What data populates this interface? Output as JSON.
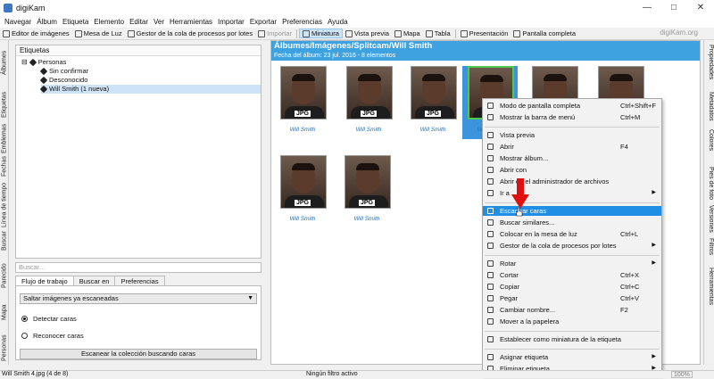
{
  "window": {
    "title": "digiKam"
  },
  "menubar": [
    "Navegar",
    "Álbum",
    "Etiqueta",
    "Elemento",
    "Editar",
    "Ver",
    "Herramientas",
    "Importar",
    "Exportar",
    "Preferencias",
    "Ayuda"
  ],
  "toolbar": {
    "items": [
      {
        "label": "Editor de imágenes",
        "state": "normal"
      },
      {
        "label": "Mesa de Luz",
        "state": "normal"
      },
      {
        "label": "Gestor de la cola de procesos por lotes",
        "state": "normal"
      },
      {
        "label": "Importar",
        "state": "disabled"
      },
      {
        "label": "Miniatura",
        "state": "active"
      },
      {
        "label": "Vista previa",
        "state": "normal"
      },
      {
        "label": "Mapa",
        "state": "normal"
      },
      {
        "label": "Tabla",
        "state": "normal"
      },
      {
        "label": "Presentación",
        "state": "normal"
      },
      {
        "label": "Pantalla completa",
        "state": "normal"
      }
    ],
    "brand": "digiKam.org"
  },
  "left_tabs": [
    "Álbumes",
    "Etiquetas",
    "Emblemas",
    "Fechas",
    "Línea de tiempo",
    "Buscar",
    "Parecido",
    "Mapa",
    "Personas"
  ],
  "right_tabs": [
    "Propiedades",
    "Metadatos",
    "Colores",
    "Pies de foto",
    "Versiones",
    "Filtros",
    "Herramientas"
  ],
  "tag_panel": {
    "header": "Etiquetas",
    "nodes": [
      {
        "label": "Personas",
        "level": 0,
        "selected": false
      },
      {
        "label": "Sin confirmar",
        "level": 1,
        "selected": false
      },
      {
        "label": "Desconocido",
        "level": 1,
        "selected": false
      },
      {
        "label": "Will Smith (1 nueva)",
        "level": 1,
        "selected": true
      }
    ]
  },
  "search": {
    "placeholder": "Buscar..."
  },
  "workflow_tabs": [
    {
      "label": "Flujo de trabajo",
      "active": true
    },
    {
      "label": "Buscar en",
      "active": false
    },
    {
      "label": "Preferencias",
      "active": false
    }
  ],
  "workflow": {
    "combo_value": "Saltar imágenes ya escaneadas",
    "radio_detect": "Detectar caras",
    "radio_recognize": "Reconocer caras",
    "scan_button": "Escanear la colección buscando caras"
  },
  "album": {
    "path": "Álbumes/Imágenes/Splitcam/Will Smith",
    "subtitle": "Fecha del álbum: 23 jul. 2016 - 8 elementos",
    "thumbs": [
      {
        "badge": "JPG",
        "caption": "Will Smith",
        "selected": false
      },
      {
        "badge": "JPG",
        "caption": "Will Smith",
        "selected": false
      },
      {
        "badge": "JPG",
        "caption": "Will Smith",
        "selected": false
      },
      {
        "badge": "JPG",
        "caption": "Will Smith",
        "selected": true
      },
      {
        "badge": "JPG",
        "caption": "Will Smith",
        "selected": false
      },
      {
        "badge": "JPG",
        "caption": "Will Smith",
        "selected": false
      },
      {
        "badge": "JPG",
        "caption": "Will Smith",
        "selected": false
      },
      {
        "badge": "JPG",
        "caption": "Will Smith",
        "selected": false
      }
    ]
  },
  "context_menu": {
    "items": [
      {
        "label": "Modo de pantalla completa",
        "shortcut": "Ctrl+Shift+F",
        "submenu": false,
        "highlighted": false,
        "sep_before": false
      },
      {
        "label": "Mostrar la barra de menú",
        "shortcut": "Ctrl+M",
        "submenu": false,
        "highlighted": false,
        "sep_before": false
      },
      {
        "label": "Vista previa",
        "shortcut": "",
        "submenu": false,
        "highlighted": false,
        "sep_before": true
      },
      {
        "label": "Abrir",
        "shortcut": "F4",
        "submenu": false,
        "highlighted": false,
        "sep_before": false
      },
      {
        "label": "Mostrar álbum...",
        "shortcut": "",
        "submenu": false,
        "highlighted": false,
        "sep_before": false
      },
      {
        "label": "Abrir con",
        "shortcut": "",
        "submenu": false,
        "highlighted": false,
        "sep_before": false
      },
      {
        "label": "Abrir en el administrador de archivos",
        "shortcut": "",
        "submenu": false,
        "highlighted": false,
        "sep_before": false
      },
      {
        "label": "Ir a",
        "shortcut": "",
        "submenu": true,
        "highlighted": false,
        "sep_before": false
      },
      {
        "label": "Escanear caras",
        "shortcut": "",
        "submenu": false,
        "highlighted": true,
        "sep_before": true
      },
      {
        "label": "Buscar similares...",
        "shortcut": "",
        "submenu": false,
        "highlighted": false,
        "sep_before": false
      },
      {
        "label": "Colocar en la mesa de luz",
        "shortcut": "Ctrl+L",
        "submenu": false,
        "highlighted": false,
        "sep_before": false
      },
      {
        "label": "Gestor de la cola de procesos por lotes",
        "shortcut": "",
        "submenu": true,
        "highlighted": false,
        "sep_before": false
      },
      {
        "label": "Rotar",
        "shortcut": "",
        "submenu": true,
        "highlighted": false,
        "sep_before": true
      },
      {
        "label": "Cortar",
        "shortcut": "Ctrl+X",
        "submenu": false,
        "highlighted": false,
        "sep_before": false
      },
      {
        "label": "Copiar",
        "shortcut": "Ctrl+C",
        "submenu": false,
        "highlighted": false,
        "sep_before": false
      },
      {
        "label": "Pegar",
        "shortcut": "Ctrl+V",
        "submenu": false,
        "highlighted": false,
        "sep_before": false
      },
      {
        "label": "Cambiar nombre...",
        "shortcut": "F2",
        "submenu": false,
        "highlighted": false,
        "sep_before": false
      },
      {
        "label": "Mover a la papelera",
        "shortcut": "",
        "submenu": false,
        "highlighted": false,
        "sep_before": false
      },
      {
        "label": "Establecer como miniatura de la etiqueta",
        "shortcut": "",
        "submenu": false,
        "highlighted": false,
        "sep_before": true
      },
      {
        "label": "Asignar etiqueta",
        "shortcut": "",
        "submenu": true,
        "highlighted": false,
        "sep_before": true
      },
      {
        "label": "Eliminar etiqueta",
        "shortcut": "",
        "submenu": true,
        "highlighted": false,
        "sep_before": false
      }
    ]
  },
  "statusbar": {
    "file": "Will Smith 4.jpg (4 de 8)",
    "filter": "Ningún filtro activo",
    "zoom": "100%"
  },
  "colors": {
    "album_header": "#3fa2e0",
    "highlight": "#1f8fe6",
    "arrow": "#e01010"
  }
}
